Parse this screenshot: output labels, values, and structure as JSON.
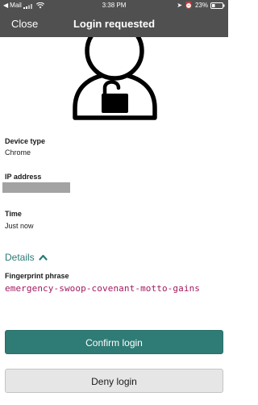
{
  "status_bar": {
    "carrier": "Mail",
    "time": "3:38 PM",
    "battery": "23%"
  },
  "nav": {
    "close_label": "Close",
    "title": "Login requested"
  },
  "device": {
    "label": "Device type",
    "value": "Chrome"
  },
  "ip": {
    "label": "IP address"
  },
  "time_info": {
    "label": "Time",
    "value": "Just now"
  },
  "details": {
    "label": "Details"
  },
  "fingerprint": {
    "label": "Fingerprint phrase",
    "value": "emergency-swoop-covenant-motto-gains"
  },
  "actions": {
    "confirm_label": "Confirm login",
    "deny_label": "Deny login"
  },
  "colors": {
    "header": "#505050",
    "accent": "#2f7b75",
    "fingerprint": "#a0195f"
  },
  "icons": {
    "hero": "user-unlocked-icon",
    "details_toggle": "chevron-up-icon"
  }
}
